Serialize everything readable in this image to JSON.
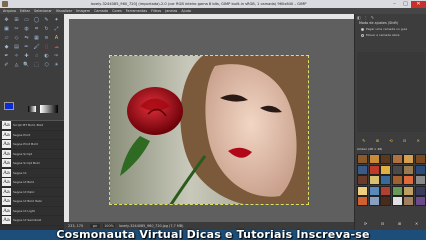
{
  "window": {
    "title": "lovely-3244085_960_720] (importada)-2.0 (cor RGB inteiro gama 8 bits, GIMP built-in sRGB, 1 camada) 960x640 – GIMP",
    "minimize": "–",
    "maximize": "□",
    "close": "✕"
  },
  "menu": [
    "Arquivo",
    "Editar",
    "Selecionar",
    "Visualizar",
    "Imagem",
    "Camada",
    "Cores",
    "Ferramentas",
    "Filtros",
    "Janelas",
    "Ajuda"
  ],
  "toolbox": {
    "icons": [
      "move-icon",
      "align-icon",
      "rect-select-icon",
      "ellipse-select-icon",
      "free-select-icon",
      "fuzzy-select-icon",
      "color-select-icon",
      "scissors-icon",
      "foreground-select-icon",
      "crop-icon",
      "rotate-icon",
      "scale-icon",
      "shear-icon",
      "perspective-icon",
      "flip-icon",
      "cage-icon",
      "warp-icon",
      "text-icon",
      "bucket-fill-icon",
      "blend-icon",
      "pencil-icon",
      "paintbrush-icon",
      "eraser-icon",
      "airbrush-icon",
      "ink-icon",
      "clone-icon",
      "heal-icon",
      "smudge-icon",
      "dodge-icon",
      "paths-icon",
      "color-picker-icon",
      "measure-icon",
      "zoom-icon",
      "unified-transform-icon",
      "handle-transform-icon",
      "mypaint-icon"
    ],
    "glyphs": [
      "✥",
      "⊞",
      "▭",
      "◯",
      "✎",
      "✦",
      "▣",
      "✂",
      "◍",
      "⌗",
      "↻",
      "⤢",
      "▱",
      "◇",
      "⇋",
      "▦",
      "≋",
      "A",
      "◆",
      "▤",
      "✏",
      "🖌",
      "▯",
      "☁",
      "✒",
      "✧",
      "✚",
      "☝",
      "◐",
      "✑",
      "✐",
      "◬",
      "🔍",
      "⬚",
      "⬡",
      "☀"
    ],
    "fg_color": "#0b2cd3",
    "bg_color": "#111111"
  },
  "fonts": {
    "items": [
      "Script MT Bold, Bold",
      "Segoe Print",
      "Segoe Print Bold",
      "Segoe Script",
      "Segoe Script Bold",
      "Segoe UI",
      "Segoe UI Bold",
      "Segoe UI Italic",
      "Segoe UI Bold Italic",
      "Segoe UI Light",
      "Segoe UI Semibold"
    ],
    "glyph": "Aa",
    "tool_icons": [
      "⬆",
      "↻",
      "✎",
      "⬇"
    ]
  },
  "canvas": {
    "coords": "233, 170",
    "unit": "px",
    "zoom": "100%",
    "status": "lovely-3244085_960_720.jpg (7,7 MB)"
  },
  "dock": {
    "tabs": [
      "◧",
      "⋮",
      "✎"
    ],
    "title": "Modo de ajustes (Shift)",
    "option_a": "Pegar uma camada ou guia",
    "option_b": "Mover a camada ativa",
    "buttons": [
      "✎",
      "⊞",
      "⟲",
      "⊟",
      "✕"
    ],
    "pattern_label": "Amber (48 × 48)",
    "pattern_colors": [
      "#8a5a2a",
      "#c98a3a",
      "#5a3a1c",
      "#b07040",
      "#d4a050",
      "#7a4a20",
      "#3a5a8a",
      "#c03a2a",
      "#e0b040",
      "#4a4a4a",
      "#9a7a50",
      "#2a4a7a",
      "#6a3a2a",
      "#d8c070",
      "#3a6a9a",
      "#a06030",
      "#e06a3a",
      "#8a8a8a",
      "#f0d080",
      "#5a8aba",
      "#b04030",
      "#6a9a5a",
      "#c0a060",
      "#3a3a5a",
      "#d06030",
      "#8aa0c0",
      "#4a2a1a",
      "#e0e0e0",
      "#a08060",
      "#6a4a8a"
    ],
    "footer_icons": [
      "⟳",
      "⊟",
      "⊞",
      "✕"
    ]
  },
  "watermark": "Cosmonauta Virtual Dicas e Tutoriais Inscreva-se"
}
